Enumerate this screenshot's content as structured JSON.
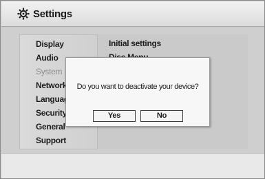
{
  "window": {
    "title": "Settings",
    "icon": "gear-icon"
  },
  "menu": {
    "items": [
      {
        "label": "Display",
        "state": "normal"
      },
      {
        "label": "Audio",
        "state": "normal"
      },
      {
        "label": "System",
        "state": "active"
      },
      {
        "label": "Network",
        "state": "normal"
      },
      {
        "label": "Language",
        "state": "normal"
      },
      {
        "label": "Security",
        "state": "normal"
      },
      {
        "label": "General",
        "state": "normal"
      },
      {
        "label": "Support",
        "state": "normal"
      }
    ]
  },
  "submenu": {
    "items": [
      {
        "label": "Initial settings"
      },
      {
        "label": "Disc Menu"
      }
    ]
  },
  "dialog": {
    "message": "Do you want to deactivate your device?",
    "yes_label": "Yes",
    "no_label": "No"
  },
  "colors": {
    "inactive_menu_text": "#8d8d8d",
    "text": "#1d1d1d"
  }
}
